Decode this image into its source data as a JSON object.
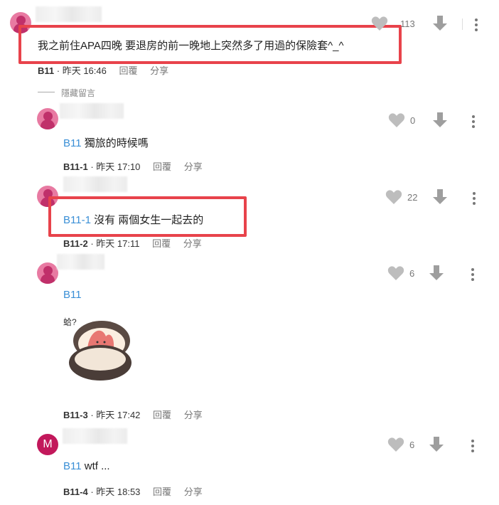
{
  "comments": [
    {
      "text": "我之前住APA四晚 要退房的前一晚地上突然多了用過的保險套^_^",
      "tag": "",
      "floor": "B11",
      "time": "昨天 16:46",
      "reply": "回覆",
      "share": "分享",
      "likes": "113"
    },
    {
      "tag": "B11",
      "text": " 獨旅的時候嗎",
      "floor": "B11-1",
      "time": "昨天 17:10",
      "reply": "回覆",
      "share": "分享",
      "likes": "0"
    },
    {
      "tag": "B11-1",
      "text": " 沒有 兩個女生一起去的",
      "floor": "B11-2",
      "time": "昨天 17:11",
      "reply": "回覆",
      "share": "分享",
      "likes": "22"
    },
    {
      "tag": "B11",
      "text": "",
      "floor": "B11-3",
      "time": "昨天 17:42",
      "reply": "回覆",
      "share": "分享",
      "likes": "6",
      "sticker_text": "蛤?"
    },
    {
      "tag": "B11",
      "text": " wtf ...",
      "floor": "B11-4",
      "time": "昨天 18:53",
      "reply": "回覆",
      "share": "分享",
      "likes": "6",
      "avatar_letter": "M"
    }
  ],
  "hidden_label": "隱藏留言",
  "colors": {
    "tag": "#3a8fd6",
    "highlight": "#e8434b",
    "avatar": "#e87aa2",
    "avatar_m": "#c2185b"
  },
  "icons": [
    "heart-icon",
    "thumbs-down-icon",
    "more-vert-icon",
    "user-avatar-icon"
  ]
}
